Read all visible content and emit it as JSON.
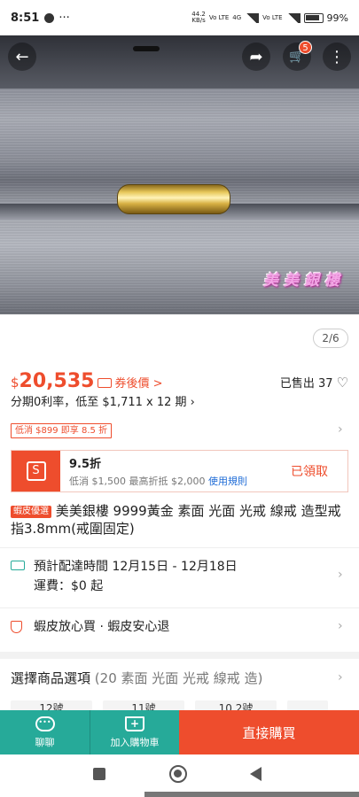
{
  "status_bar": {
    "time": "8:51",
    "net_speed_top": "44.2",
    "net_speed_bottom": "KB/s",
    "volte1": "Vo LTE",
    "net_4g": "4G",
    "volte2": "Vo LTE",
    "battery": "99%"
  },
  "header": {
    "back_glyph": "←",
    "share_glyph": "➦",
    "cart_glyph": "🛒",
    "more_glyph": "⋮",
    "cart_badge": "5"
  },
  "image": {
    "watermark": "美美銀樓",
    "page_indicator": "2/6"
  },
  "price": {
    "currency": "$",
    "value": "20,535",
    "coupon_label": "券後價 >",
    "sold_label": "已售出 37",
    "heart_glyph": "♡"
  },
  "installment": "分期0利率，低至 $1,711 x 12 期 ›",
  "promo_chip": "低消 $899 即享 8.5 折",
  "voucher": {
    "title": "9.5折",
    "desc": "低消 $1,500 最高折抵 $2,000",
    "link": "使用規則",
    "claimed": "已領取",
    "bag_glyph": "S"
  },
  "product": {
    "tag": "蝦皮優選",
    "title": "美美銀樓 9999黃金  素面 光面  光戒 線戒 造型戒指3.8mm(戒圍固定)"
  },
  "delivery": {
    "eta": "預計配達時間 12月15日 - 12月18日",
    "fee": "運費：$0 起"
  },
  "assurance": "蝦皮放心買 · 蝦皮安心退",
  "options": {
    "label": "選擇商品選項",
    "detail": "(20 素面 光面  光戒 線戒 造)",
    "chips": [
      "12號",
      "11號",
      "10.2號",
      ""
    ]
  },
  "chevron_glyph": "›",
  "bottom_bar": {
    "chat_label": "聊聊",
    "add_cart_label": "加入購物車",
    "buy_label": "直接購買"
  },
  "colors": {
    "brand": "#ee4d2d",
    "teal": "#26aa99",
    "link": "#1e6bd6"
  }
}
